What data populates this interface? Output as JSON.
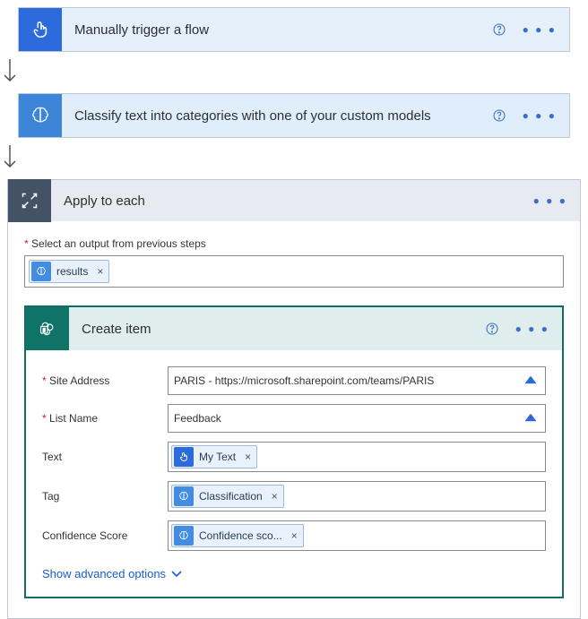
{
  "step1": {
    "title": "Manually trigger a flow",
    "icon": "hand-tap-icon"
  },
  "step2": {
    "title": "Classify text into categories with one of your custom models",
    "icon": "ai-brain-icon"
  },
  "each": {
    "title": "Apply to each",
    "selectLabel": "Select an output from previous steps",
    "token": {
      "label": "results",
      "icon": "ai-brain-icon"
    }
  },
  "createItem": {
    "title": "Create item",
    "icon": "sharepoint-icon",
    "fields": {
      "siteAddress": {
        "label": "Site Address",
        "value": "PARIS - https://microsoft.sharepoint.com/teams/PARIS"
      },
      "listName": {
        "label": "List Name",
        "value": "Feedback"
      },
      "text": {
        "label": "Text",
        "token": {
          "label": "My Text",
          "icon": "hand-tap-icon"
        }
      },
      "tag": {
        "label": "Tag",
        "token": {
          "label": "Classification",
          "icon": "ai-brain-icon"
        }
      },
      "confidence": {
        "label": "Confidence Score",
        "token": {
          "label": "Confidence sco...",
          "icon": "ai-brain-icon"
        }
      }
    },
    "advanced": "Show advanced options"
  }
}
